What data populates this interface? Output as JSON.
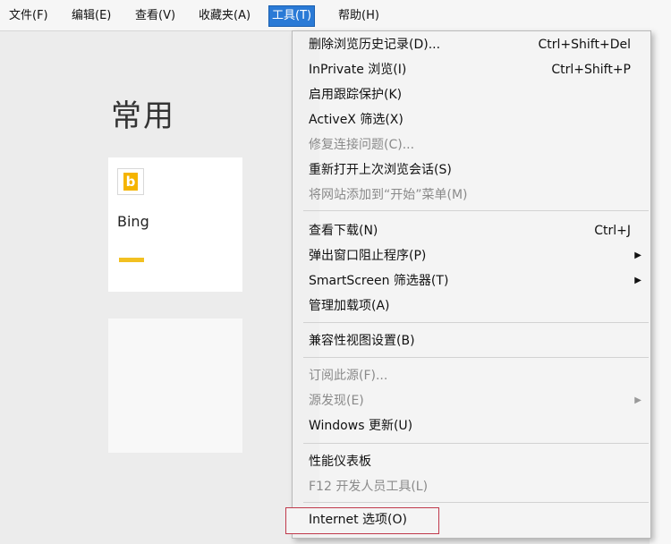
{
  "menubar": {
    "items": [
      "文件(F)",
      "编辑(E)",
      "查看(V)",
      "收藏夹(A)",
      "工具(T)",
      "帮助(H)"
    ]
  },
  "page": {
    "heading": "常用",
    "tile_label": "Bing",
    "tile_icon": "bing-logo-icon"
  },
  "tools_menu": {
    "items": [
      {
        "label": "删除浏览历史记录(D)...",
        "shortcut": "Ctrl+Shift+Del"
      },
      {
        "label": "InPrivate 浏览(I)",
        "shortcut": "Ctrl+Shift+P"
      },
      {
        "label": "启用跟踪保护(K)"
      },
      {
        "label": "ActiveX 筛选(X)"
      },
      {
        "label": "修复连接问题(C)...",
        "disabled": true
      },
      {
        "label": "重新打开上次浏览会话(S)"
      },
      {
        "label": "将网站添加到“开始”菜单(M)",
        "disabled": true
      },
      {
        "label": "查看下载(N)",
        "shortcut": "Ctrl+J"
      },
      {
        "label": "弹出窗口阻止程序(P)",
        "submenu": true
      },
      {
        "label": "SmartScreen 筛选器(T)",
        "submenu": true
      },
      {
        "label": "管理加载项(A)"
      },
      {
        "label": "兼容性视图设置(B)"
      },
      {
        "label": "订阅此源(F)...",
        "disabled": true
      },
      {
        "label": "源发现(E)",
        "disabled": true,
        "submenu": true
      },
      {
        "label": "Windows 更新(U)"
      },
      {
        "label": "性能仪表板"
      },
      {
        "label": "F12 开发人员工具(L)",
        "disabled": true
      },
      {
        "label": "Internet 选项(O)"
      }
    ]
  },
  "colors": {
    "active_menu": "#2a7ad6",
    "highlight_box": "#c0394b",
    "bing_yellow": "#f5b400"
  }
}
